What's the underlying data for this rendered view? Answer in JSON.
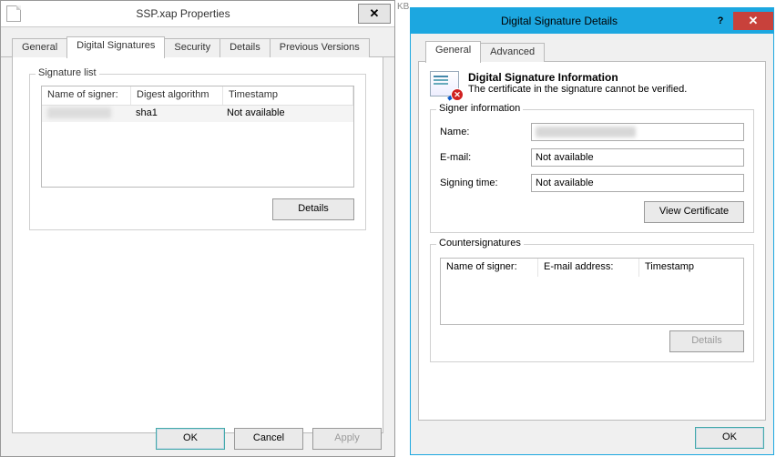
{
  "stray": {
    "kb": "KB"
  },
  "props": {
    "title": "SSP.xap Properties",
    "closeGlyph": "✕",
    "tabs": [
      "General",
      "Digital Signatures",
      "Security",
      "Details",
      "Previous Versions"
    ],
    "activeTab": 1,
    "signatureList": {
      "group": "Signature list",
      "headers": {
        "name": "Name of signer:",
        "alg": "Digest algorithm",
        "ts": "Timestamp"
      },
      "row": {
        "name": "",
        "alg": "sha1",
        "ts": "Not available"
      },
      "detailsBtn": "Details"
    },
    "buttons": {
      "ok": "OK",
      "cancel": "Cancel",
      "apply": "Apply"
    }
  },
  "sig": {
    "title": "Digital Signature Details",
    "helpGlyph": "?",
    "closeGlyph": "✕",
    "tabs": [
      "General",
      "Advanced"
    ],
    "info": {
      "heading": "Digital Signature Information",
      "sub": "The certificate in the signature cannot be verified."
    },
    "signer": {
      "group": "Signer information",
      "nameLabel": "Name:",
      "nameValue": "",
      "emailLabel": "E-mail:",
      "emailValue": "Not available",
      "timeLabel": "Signing time:",
      "timeValue": "Not available",
      "viewCert": "View Certificate"
    },
    "cs": {
      "group": "Countersignatures",
      "headers": {
        "name": "Name of signer:",
        "email": "E-mail address:",
        "ts": "Timestamp"
      },
      "details": "Details"
    },
    "ok": "OK"
  }
}
